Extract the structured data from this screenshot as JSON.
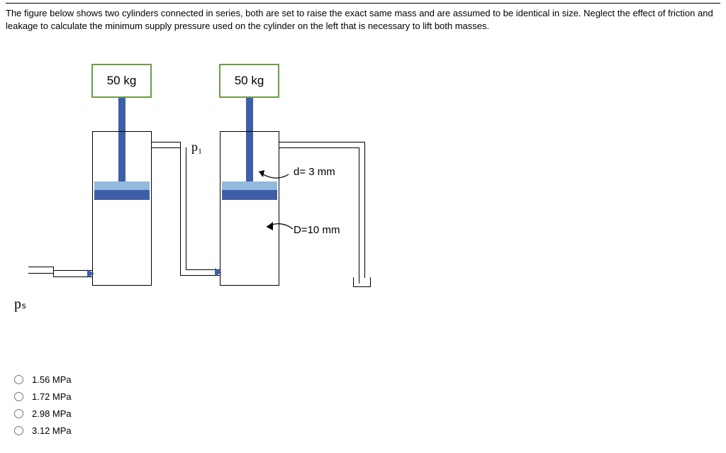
{
  "question": "The figure below shows two cylinders connected in series, both are set to raise the exact same mass and are assumed to be identical in size. Neglect the effect of friction and leakage to calculate the minimum supply pressure used on the cylinder on the left that is necessary to lift both masses.",
  "masses": {
    "left": "50 kg",
    "right": "50 kg"
  },
  "labels": {
    "p1": "p₁",
    "ps": "pₛ",
    "d_small": "d= 3 mm",
    "d_large": "D=10 mm"
  },
  "options": [
    "1.56 MPa",
    "1.72 MPa",
    "2.98 MPa",
    "3.12 MPa"
  ]
}
